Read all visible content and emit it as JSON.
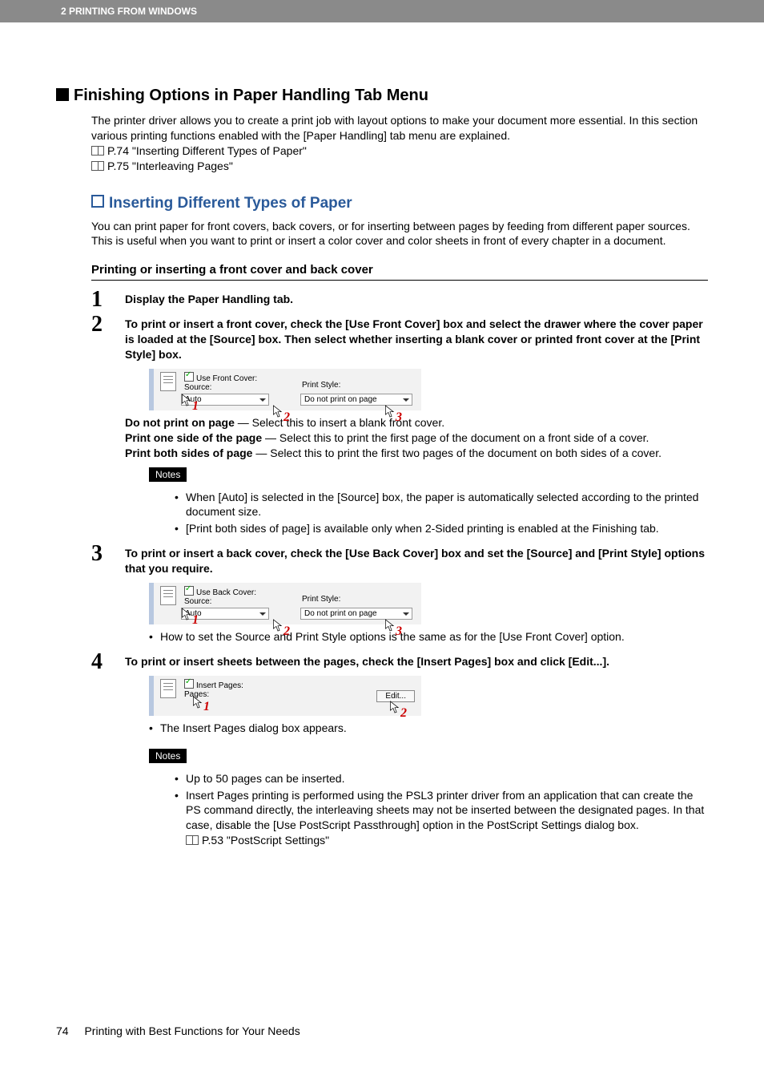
{
  "header": {
    "chapter": "2 PRINTING FROM WINDOWS"
  },
  "h1": "Finishing Options in Paper Handling Tab Menu",
  "intro": {
    "line1": "The printer driver allows you to create a print job with layout options to make your document more essential.  In this section various printing functions enabled with the [Paper Handling] tab menu are explained.",
    "ref1": "P.74 \"Inserting Different Types of Paper\"",
    "ref2": "P.75 \"Interleaving Pages\""
  },
  "h2": "Inserting Different Types of Paper",
  "p1": "You can print paper for front covers, back covers, or for inserting between pages by feeding from different paper sources. This is useful when you want to print or insert a color cover and color sheets in front of every chapter in a document.",
  "h3": "Printing or inserting a front cover and back cover",
  "steps": [
    {
      "title": "Display the Paper Handling tab."
    },
    {
      "title": "To print or insert a front cover, check the [Use Front Cover] box and select the drawer where the cover paper is loaded at the [Source] box.  Then select whether inserting a blank cover or printed front cover at the [Print Style] box.",
      "fig": {
        "chkLabel": "Use Front Cover:",
        "leftLabel": "Source:",
        "leftVal": "Auto",
        "rightLabel": "Print Style:",
        "rightVal": "Do not print on page",
        "c1": "1",
        "c2": "2",
        "c3": "3"
      },
      "descLines": [
        {
          "b": "Do not print on page",
          "t": " — Select this to insert a blank front cover."
        },
        {
          "b": "Print one side of the page",
          "t": " — Select this to print the first page of the document on a front side of a cover."
        },
        {
          "b": "Print both sides of page",
          "t": " — Select this to print the first two pages of the document on both sides of a cover."
        }
      ],
      "notesLabel": "Notes",
      "notes": [
        "When [Auto] is selected in the [Source] box, the paper is automatically selected according to the printed document size.",
        "[Print both sides of page] is available only when 2-Sided printing is enabled at the Finishing tab."
      ]
    },
    {
      "title": "To print or insert a back cover, check the [Use Back Cover] box and set the [Source] and [Print Style] options that you require.",
      "fig": {
        "chkLabel": "Use Back Cover:",
        "leftLabel": "Source:",
        "leftVal": "Auto",
        "rightLabel": "Print Style:",
        "rightVal": "Do not print on page",
        "c1": "1",
        "c2": "2",
        "c3": "3"
      },
      "after": "How to set the Source and Print Style options is the same as for the [Use Front Cover] option."
    },
    {
      "title": "To print or insert sheets between the pages, check the [Insert Pages] box and click [Edit...].",
      "fig": {
        "chkLabel": "Insert Pages:",
        "leftLabel": "Pages:",
        "btn": "Edit...",
        "c1": "1",
        "c2": "2"
      },
      "after": "The Insert Pages dialog box appears.",
      "notesLabel": "Notes",
      "notes": [
        "Up to 50 pages can be inserted.",
        "Insert Pages printing is performed using the PSL3 printer driver from an application that can create the PS command directly, the interleaving sheets may not be inserted between the designated pages. In that case, disable the [Use PostScript Passthrough] option in the PostScript Settings dialog box."
      ],
      "ref": "P.53 \"PostScript Settings\""
    }
  ],
  "footer": {
    "page": "74",
    "title": "Printing with Best Functions for Your Needs"
  }
}
